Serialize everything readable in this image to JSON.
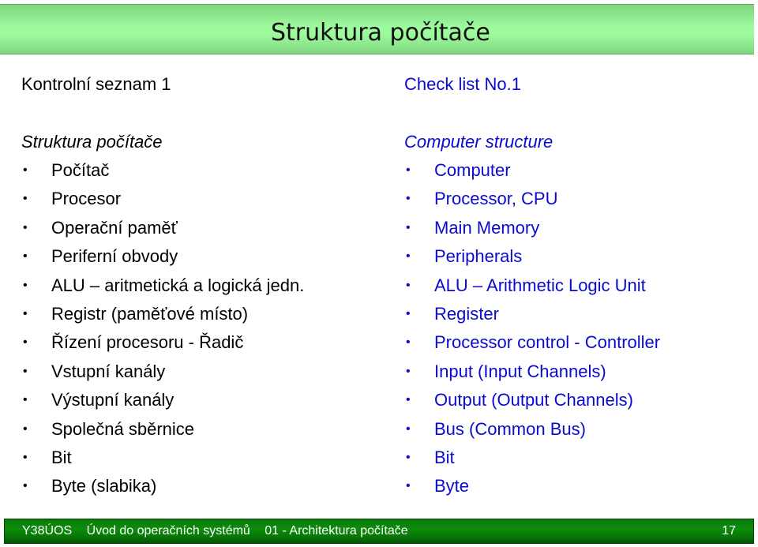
{
  "slide": {
    "title": "Struktura počítače"
  },
  "left_column": {
    "heading": "Kontrolní seznam 1",
    "section": "Struktura počítače",
    "items": [
      "Počítač",
      "Procesor",
      "Operační paměť",
      "Periferní obvody",
      "ALU – aritmetická a logická jedn.",
      "Registr (paměťové místo)",
      "Řízení procesoru - Řadič",
      "Vstupní kanály",
      "Výstupní kanály",
      "Společná sběrnice",
      "Bit",
      "Byte (slabika)"
    ]
  },
  "right_column": {
    "heading": "Check list No.1",
    "section": "Computer structure",
    "items": [
      "Computer",
      "Processor, CPU",
      "Main Memory",
      "Peripherals",
      "ALU – Arithmetic Logic Unit",
      "Register",
      "Processor control - Controller",
      "Input (Input Channels)",
      "Output (Output Channels)",
      "Bus (Common Bus)",
      "Bit",
      "Byte"
    ]
  },
  "bullet_glyph": "•",
  "footer": {
    "course_code": "Y38ÚOS",
    "course_name": "Úvod do operačních systémů",
    "lecture": "01 - Architektura počítače",
    "page_number": "17"
  },
  "colors": {
    "english_text": "#0a0ad0",
    "title_bar": "#9dfb9d",
    "footer_bar": "#0c8c0c"
  }
}
